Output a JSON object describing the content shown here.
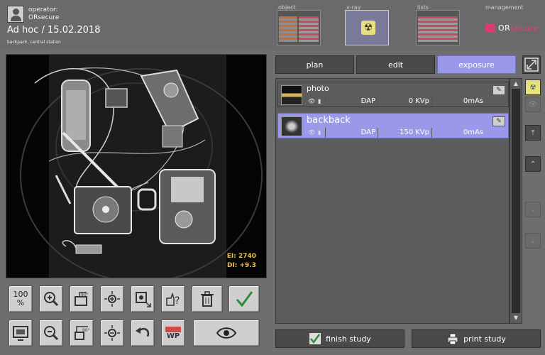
{
  "header": {
    "operator_label": "operator:",
    "operator_name": "ORsecure",
    "study_title": "Ad hoc / 15.02.2018",
    "study_subtitle": "backpack, central station"
  },
  "nav_tabs": [
    {
      "label": "object",
      "active": false
    },
    {
      "label": "x-ray",
      "active": true
    },
    {
      "label": "lists",
      "active": false
    },
    {
      "label": "management",
      "active": false
    }
  ],
  "brand": {
    "prefix": "OR",
    "name": "secure"
  },
  "image": {
    "dose": {
      "ei": "EI:  2740",
      "di": "DI:  +9.3"
    }
  },
  "tools_row1": [
    {
      "name": "zoom-100-button",
      "label": "100\n%"
    },
    {
      "name": "zoom-in-button",
      "icon": "magnifier-plus-icon"
    },
    {
      "name": "rotate-90-button",
      "icon": "rotate-90-icon"
    },
    {
      "name": "brightness-up-button",
      "icon": "sun-plus-icon"
    },
    {
      "name": "region-zoom-button",
      "icon": "region-zoom-icon"
    },
    {
      "name": "help-button",
      "icon": "hand-question-icon"
    },
    {
      "name": "delete-button",
      "icon": "trash-icon"
    },
    {
      "name": "accept-button",
      "icon": "checkmark-icon"
    }
  ],
  "tools_row2": [
    {
      "name": "fit-screen-button",
      "icon": "monitor-icon"
    },
    {
      "name": "zoom-out-button",
      "icon": "magnifier-minus-icon"
    },
    {
      "name": "rotate-minus-90-button",
      "icon": "rotate-minus-90-icon"
    },
    {
      "name": "brightness-down-button",
      "icon": "sun-minus-icon"
    },
    {
      "name": "undo-button",
      "icon": "undo-arrow-icon"
    },
    {
      "name": "wp-button",
      "label": "WP"
    },
    {
      "name": "view-button",
      "icon": "eye-icon"
    }
  ],
  "right_tabs": [
    {
      "label": "plan",
      "active": false
    },
    {
      "label": "edit",
      "active": false
    },
    {
      "label": "exposure",
      "active": true
    }
  ],
  "exposures": [
    {
      "name": "photo",
      "dap": "DAP",
      "kvp": "0 KVp",
      "mas": "0mAs",
      "selected": false
    },
    {
      "name": "backback",
      "dap": "DAP",
      "kvp": "150 KVp",
      "mas": "0mAs",
      "selected": true
    }
  ],
  "bottom": {
    "finish_label": "finish study",
    "print_label": "print study"
  },
  "colors": {
    "accent": "#9a98e8",
    "brand": "#d83c72",
    "dose": "#f0c040",
    "radiation": "#e8e080"
  }
}
